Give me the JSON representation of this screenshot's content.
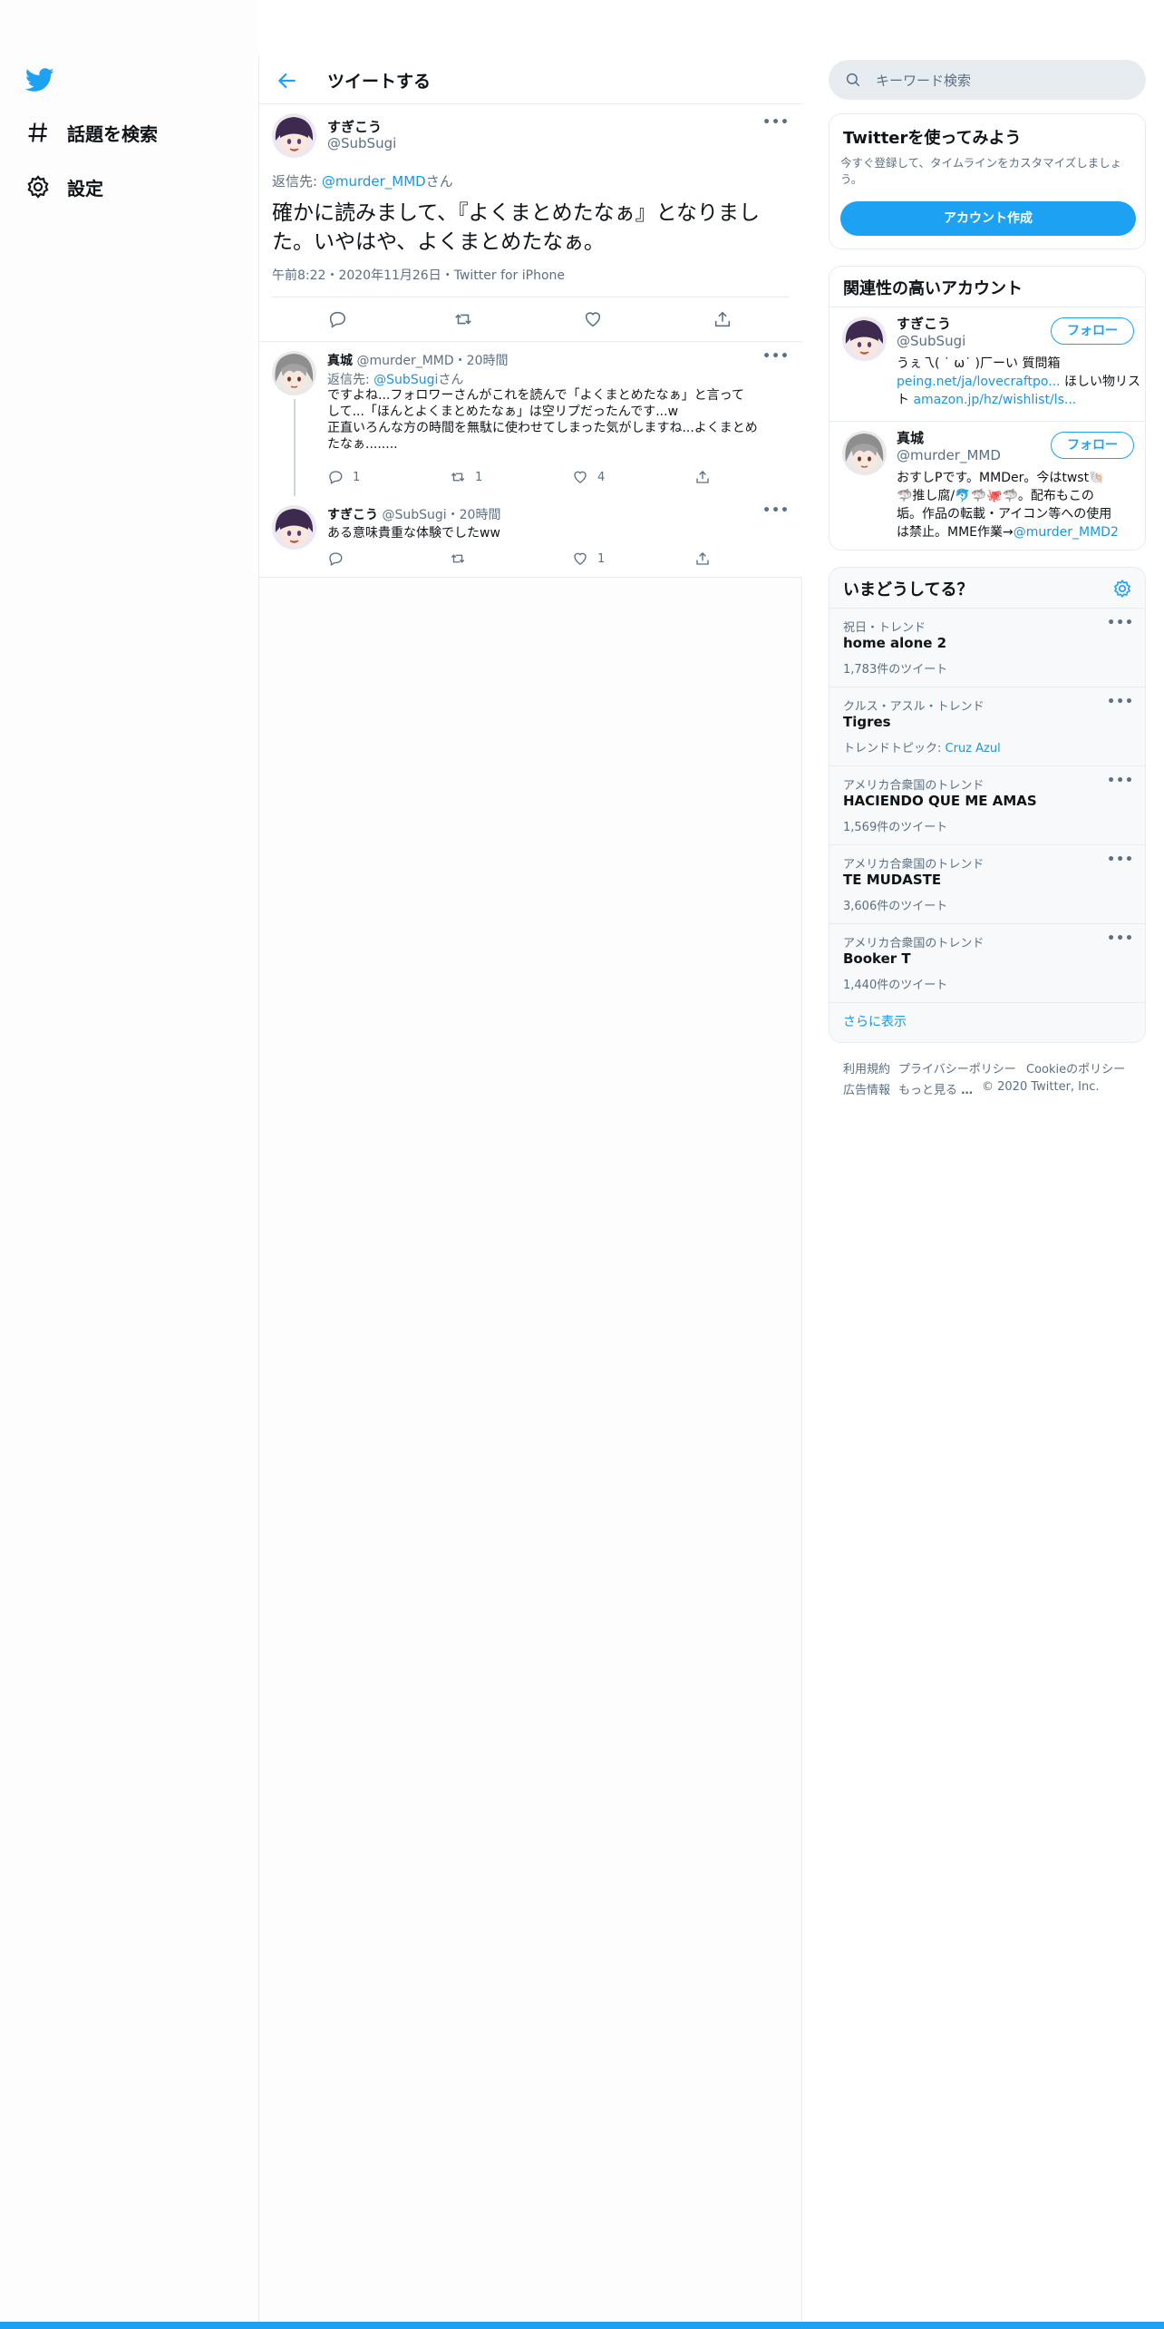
{
  "nav": {
    "items": [
      {
        "label": "話題を検索"
      },
      {
        "label": "設定"
      }
    ]
  },
  "header": {
    "title": "ツイートする"
  },
  "main_tweet": {
    "name": "すぎこう",
    "handle": "@SubSugi",
    "reply_prefix": "返信先: ",
    "reply_to": "@murder_MMD",
    "reply_suffix": "さん",
    "text": "確かに読みまして、『よくまとめたなぁ』となりました。いやはや、よくまとめたなぁ。",
    "meta": "午前8:22・2020年11月26日・Twitter for iPhone"
  },
  "replies": [
    {
      "name": "真城",
      "handle": "@murder_MMD",
      "time": "・20時間",
      "reply_prefix": "返信先: ",
      "reply_to": "@SubSugi",
      "reply_suffix": "さん",
      "text_line1": "ですよね...フォロワーさんがこれを読んで「よくまとめたなぁ」と言って",
      "text_line2": "して...「ほんとよくまとめたなぁ」は空リプだったんです...w",
      "text_line3": "正直いろんな方の時間を無駄に使わせてしまった気がしますね...よくまとめ",
      "text_line4": "たなぁ........",
      "replies": "1",
      "retweets": "1",
      "likes": "4"
    },
    {
      "name": "すぎこう",
      "handle": "@SubSugi",
      "time": "・20時間",
      "text": "ある意味貴重な体験でしたww",
      "replies": "",
      "retweets": "",
      "likes": "1"
    }
  ],
  "search": {
    "placeholder": "キーワード検索"
  },
  "signup": {
    "title": "Twitterを使ってみよう",
    "desc_line1": "今すぐ登録して、タイムラインをカスタマイズしましょ",
    "desc_line2": "う。",
    "button": "アカウント作成"
  },
  "relevant": {
    "title": "関連性の高いアカウント",
    "follow_label": "フォロー",
    "accounts": [
      {
        "name": "すぎこう",
        "handle": "@SubSugi",
        "bio_line1": "うぇ乁( ˙ ω˙ )厂ーい 質問箱",
        "bio_link1": "peing.net/ja/lovecraftpo...",
        "bio_after1": " ほしい物リス",
        "bio_line3_prefix": "ト ",
        "bio_link2": "amazon.jp/hz/wishlist/ls..."
      },
      {
        "name": "真城",
        "handle": "@murder_MMD",
        "bio_line1": "おすしPです。MMDer。今はtwst🐚",
        "bio_line2": "🦈推し腐/🐬🦈🐙🦈。配布もこの",
        "bio_line3": "垢。作品の転載・アイコン等への使用",
        "bio_line4_prefix": "は禁止。MME作業→",
        "bio_link": "@murder_MMD2"
      }
    ]
  },
  "trends": {
    "title": "いまどうしてる？",
    "show_more": "さらに表示",
    "items": [
      {
        "meta": "祝日・トレンド",
        "name": "home alone 2",
        "count": "1,783件のツイート"
      },
      {
        "meta": "クルス・アスル・トレンド",
        "name": "Tigres",
        "count_prefix": "トレンドトピック: ",
        "count_link": "Cruz Azul"
      },
      {
        "meta": "アメリカ合衆国のトレンド",
        "name": "HACIENDO QUE ME AMAS",
        "count": "1,569件のツイート"
      },
      {
        "meta": "アメリカ合衆国のトレンド",
        "name": "TE MUDASTE",
        "count": "3,606件のツイート"
      },
      {
        "meta": "アメリカ合衆国のトレンド",
        "name": "Booker T",
        "count": "1,440件のツイート"
      }
    ]
  },
  "footer": {
    "terms": "利用規約",
    "privacy": "プライバシーポリシー",
    "cookie": "Cookieのポリシー",
    "ads": "広告情報",
    "more": "もっと見る",
    "copyright": "© 2020 Twitter, Inc."
  },
  "colors": {
    "accent": "#1da1f2",
    "link": "#1b95e0",
    "muted": "#5b7083"
  }
}
